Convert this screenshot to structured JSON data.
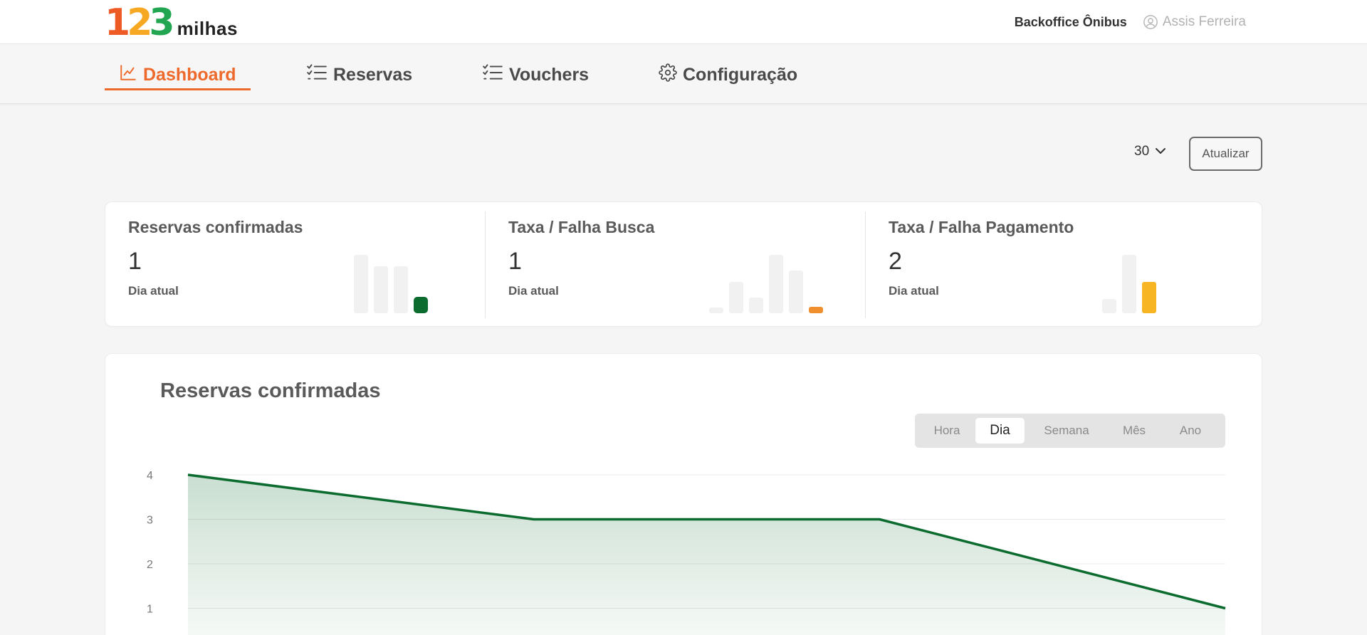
{
  "header": {
    "logo": {
      "digits": [
        "1",
        "2",
        "3"
      ],
      "word": "milhas"
    },
    "app_name": "Backoffice Ônibus",
    "user_name": "Assis Ferreira",
    "user_icon": "user-circle-icon"
  },
  "nav": {
    "tabs": [
      {
        "label": "Dashboard",
        "icon": "line-chart-icon",
        "active": true
      },
      {
        "label": "Reservas",
        "icon": "checklist-icon",
        "active": false
      },
      {
        "label": "Vouchers",
        "icon": "checklist-icon",
        "active": false
      },
      {
        "label": "Configuração",
        "icon": "gear-icon",
        "active": false
      }
    ]
  },
  "controls": {
    "days_selected": "30",
    "refresh_label": "Atualizar"
  },
  "stats": [
    {
      "label": "Reservas confirmadas",
      "value": "1",
      "sub": "Dia atual",
      "accent": "#0c6b2e"
    },
    {
      "label": "Taxa / Falha Busca",
      "value": "1",
      "sub": "Dia atual",
      "accent": "#ef8f2e"
    },
    {
      "label": "Taxa / Falha Pagamento",
      "value": "2",
      "sub": "Dia atual",
      "accent": "#f7b524"
    }
  ],
  "chart_panel": {
    "title": "Reservas confirmadas",
    "periods": [
      {
        "label": "Hora",
        "active": false
      },
      {
        "label": "Dia",
        "active": true
      },
      {
        "label": "Semana",
        "active": false
      },
      {
        "label": "Mês",
        "active": false
      },
      {
        "label": "Ano",
        "active": false
      }
    ]
  },
  "chart_data": {
    "type": "area",
    "x": [
      1,
      2,
      3,
      4
    ],
    "values": [
      4,
      3,
      3,
      1
    ],
    "y_ticks": [
      "1",
      "2",
      "3",
      "4"
    ],
    "ylim": [
      0,
      4
    ],
    "grid": true,
    "color": "#0c6b2e"
  },
  "colors": {
    "brand_orange": "#ee6a2c",
    "green": "#0c6b2e"
  }
}
